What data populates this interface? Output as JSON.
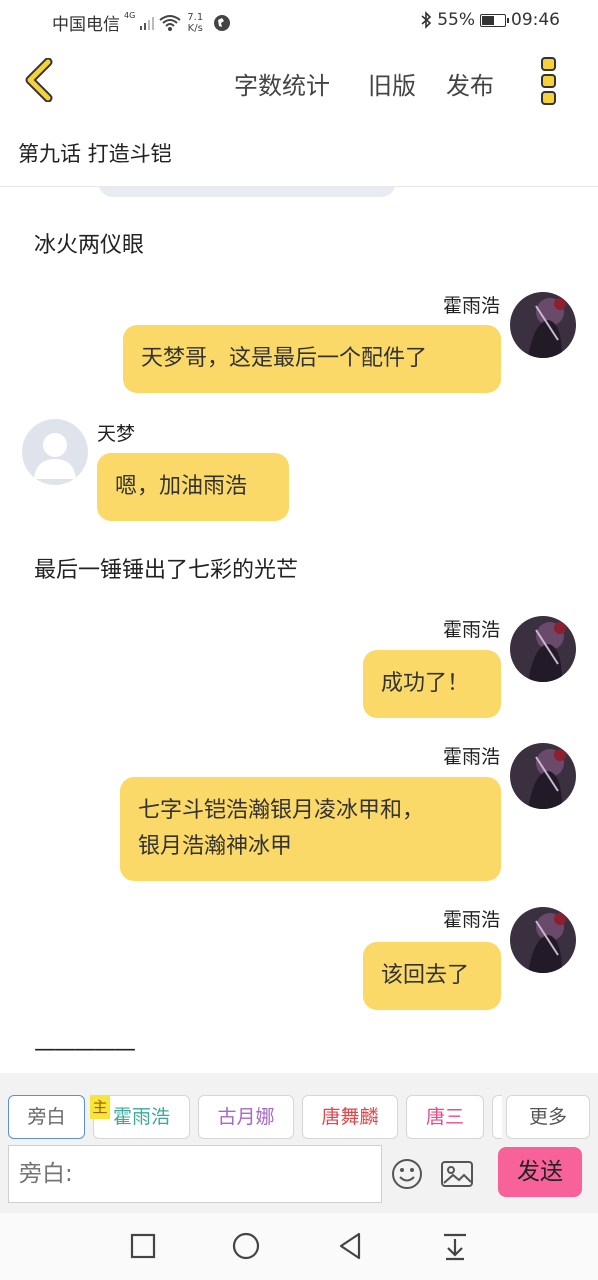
{
  "status_bar": {
    "carrier": "中国电信",
    "network": "4G",
    "speed_value": "7.1",
    "speed_unit": "K/s",
    "battery": "55%",
    "battery_level": 0.55,
    "time": "09:46"
  },
  "toolbar": {
    "word_count": "字数统计",
    "old_version": "旧版",
    "publish": "发布"
  },
  "chapter": {
    "title": "第九话 打造斗铠"
  },
  "messages": [
    {
      "type": "narration",
      "text": "冰火两仪眼"
    },
    {
      "type": "right",
      "speaker": "霍雨浩",
      "text": "天梦哥，这是最后一个配件了"
    },
    {
      "type": "left",
      "speaker": "天梦",
      "text": "嗯，加油雨浩"
    },
    {
      "type": "narration",
      "text": "最后一锤锤出了七彩的光芒"
    },
    {
      "type": "right",
      "speaker": "霍雨浩",
      "text": "成功了！"
    },
    {
      "type": "right",
      "speaker": "霍雨浩",
      "lines": [
        "七字斗铠浩瀚银月凌冰甲和，",
        "银月浩瀚神冰甲"
      ]
    },
    {
      "type": "right",
      "speaker": "霍雨浩",
      "text": "该回去了"
    },
    {
      "type": "narration",
      "text": "—————"
    }
  ],
  "roles": [
    {
      "label": "旁白",
      "color": "#666666"
    },
    {
      "label": "霍雨浩",
      "color": "#3aaa9a"
    },
    {
      "label": "古月娜",
      "color": "#a868c8"
    },
    {
      "label": "唐舞麟",
      "color": "#e0484c"
    },
    {
      "label": "唐三",
      "color": "#e84c8c"
    },
    {
      "label": "更多",
      "color": "#555555"
    }
  ],
  "main_tag": "主",
  "input": {
    "placeholder": "旁白:"
  },
  "send_label": "发送",
  "colors": {
    "bubble": "#fbd968",
    "send": "#f8629a",
    "active_role_border": "#5b8fd6"
  }
}
